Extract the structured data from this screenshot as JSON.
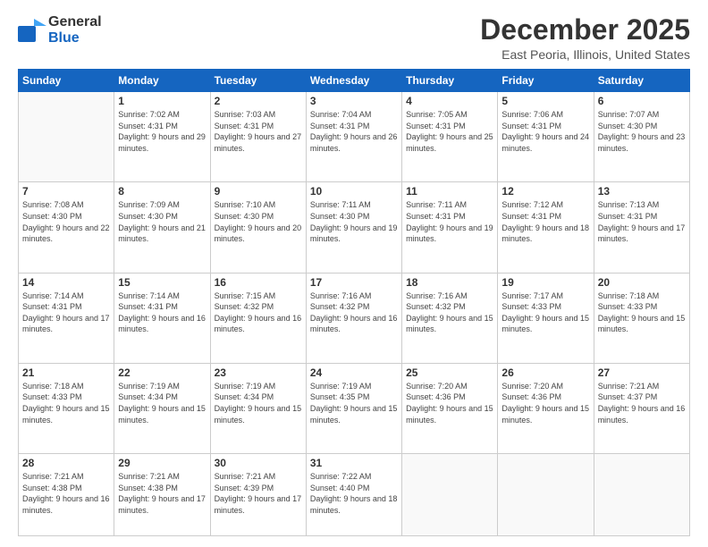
{
  "logo": {
    "general": "General",
    "blue": "Blue"
  },
  "header": {
    "month": "December 2025",
    "location": "East Peoria, Illinois, United States"
  },
  "weekdays": [
    "Sunday",
    "Monday",
    "Tuesday",
    "Wednesday",
    "Thursday",
    "Friday",
    "Saturday"
  ],
  "weeks": [
    [
      {
        "day": "",
        "sunrise": "",
        "sunset": "",
        "daylight": ""
      },
      {
        "day": "1",
        "sunrise": "Sunrise: 7:02 AM",
        "sunset": "Sunset: 4:31 PM",
        "daylight": "Daylight: 9 hours and 29 minutes."
      },
      {
        "day": "2",
        "sunrise": "Sunrise: 7:03 AM",
        "sunset": "Sunset: 4:31 PM",
        "daylight": "Daylight: 9 hours and 27 minutes."
      },
      {
        "day": "3",
        "sunrise": "Sunrise: 7:04 AM",
        "sunset": "Sunset: 4:31 PM",
        "daylight": "Daylight: 9 hours and 26 minutes."
      },
      {
        "day": "4",
        "sunrise": "Sunrise: 7:05 AM",
        "sunset": "Sunset: 4:31 PM",
        "daylight": "Daylight: 9 hours and 25 minutes."
      },
      {
        "day": "5",
        "sunrise": "Sunrise: 7:06 AM",
        "sunset": "Sunset: 4:31 PM",
        "daylight": "Daylight: 9 hours and 24 minutes."
      },
      {
        "day": "6",
        "sunrise": "Sunrise: 7:07 AM",
        "sunset": "Sunset: 4:30 PM",
        "daylight": "Daylight: 9 hours and 23 minutes."
      }
    ],
    [
      {
        "day": "7",
        "sunrise": "Sunrise: 7:08 AM",
        "sunset": "Sunset: 4:30 PM",
        "daylight": "Daylight: 9 hours and 22 minutes."
      },
      {
        "day": "8",
        "sunrise": "Sunrise: 7:09 AM",
        "sunset": "Sunset: 4:30 PM",
        "daylight": "Daylight: 9 hours and 21 minutes."
      },
      {
        "day": "9",
        "sunrise": "Sunrise: 7:10 AM",
        "sunset": "Sunset: 4:30 PM",
        "daylight": "Daylight: 9 hours and 20 minutes."
      },
      {
        "day": "10",
        "sunrise": "Sunrise: 7:11 AM",
        "sunset": "Sunset: 4:30 PM",
        "daylight": "Daylight: 9 hours and 19 minutes."
      },
      {
        "day": "11",
        "sunrise": "Sunrise: 7:11 AM",
        "sunset": "Sunset: 4:31 PM",
        "daylight": "Daylight: 9 hours and 19 minutes."
      },
      {
        "day": "12",
        "sunrise": "Sunrise: 7:12 AM",
        "sunset": "Sunset: 4:31 PM",
        "daylight": "Daylight: 9 hours and 18 minutes."
      },
      {
        "day": "13",
        "sunrise": "Sunrise: 7:13 AM",
        "sunset": "Sunset: 4:31 PM",
        "daylight": "Daylight: 9 hours and 17 minutes."
      }
    ],
    [
      {
        "day": "14",
        "sunrise": "Sunrise: 7:14 AM",
        "sunset": "Sunset: 4:31 PM",
        "daylight": "Daylight: 9 hours and 17 minutes."
      },
      {
        "day": "15",
        "sunrise": "Sunrise: 7:14 AM",
        "sunset": "Sunset: 4:31 PM",
        "daylight": "Daylight: 9 hours and 16 minutes."
      },
      {
        "day": "16",
        "sunrise": "Sunrise: 7:15 AM",
        "sunset": "Sunset: 4:32 PM",
        "daylight": "Daylight: 9 hours and 16 minutes."
      },
      {
        "day": "17",
        "sunrise": "Sunrise: 7:16 AM",
        "sunset": "Sunset: 4:32 PM",
        "daylight": "Daylight: 9 hours and 16 minutes."
      },
      {
        "day": "18",
        "sunrise": "Sunrise: 7:16 AM",
        "sunset": "Sunset: 4:32 PM",
        "daylight": "Daylight: 9 hours and 15 minutes."
      },
      {
        "day": "19",
        "sunrise": "Sunrise: 7:17 AM",
        "sunset": "Sunset: 4:33 PM",
        "daylight": "Daylight: 9 hours and 15 minutes."
      },
      {
        "day": "20",
        "sunrise": "Sunrise: 7:18 AM",
        "sunset": "Sunset: 4:33 PM",
        "daylight": "Daylight: 9 hours and 15 minutes."
      }
    ],
    [
      {
        "day": "21",
        "sunrise": "Sunrise: 7:18 AM",
        "sunset": "Sunset: 4:33 PM",
        "daylight": "Daylight: 9 hours and 15 minutes."
      },
      {
        "day": "22",
        "sunrise": "Sunrise: 7:19 AM",
        "sunset": "Sunset: 4:34 PM",
        "daylight": "Daylight: 9 hours and 15 minutes."
      },
      {
        "day": "23",
        "sunrise": "Sunrise: 7:19 AM",
        "sunset": "Sunset: 4:34 PM",
        "daylight": "Daylight: 9 hours and 15 minutes."
      },
      {
        "day": "24",
        "sunrise": "Sunrise: 7:19 AM",
        "sunset": "Sunset: 4:35 PM",
        "daylight": "Daylight: 9 hours and 15 minutes."
      },
      {
        "day": "25",
        "sunrise": "Sunrise: 7:20 AM",
        "sunset": "Sunset: 4:36 PM",
        "daylight": "Daylight: 9 hours and 15 minutes."
      },
      {
        "day": "26",
        "sunrise": "Sunrise: 7:20 AM",
        "sunset": "Sunset: 4:36 PM",
        "daylight": "Daylight: 9 hours and 15 minutes."
      },
      {
        "day": "27",
        "sunrise": "Sunrise: 7:21 AM",
        "sunset": "Sunset: 4:37 PM",
        "daylight": "Daylight: 9 hours and 16 minutes."
      }
    ],
    [
      {
        "day": "28",
        "sunrise": "Sunrise: 7:21 AM",
        "sunset": "Sunset: 4:38 PM",
        "daylight": "Daylight: 9 hours and 16 minutes."
      },
      {
        "day": "29",
        "sunrise": "Sunrise: 7:21 AM",
        "sunset": "Sunset: 4:38 PM",
        "daylight": "Daylight: 9 hours and 17 minutes."
      },
      {
        "day": "30",
        "sunrise": "Sunrise: 7:21 AM",
        "sunset": "Sunset: 4:39 PM",
        "daylight": "Daylight: 9 hours and 17 minutes."
      },
      {
        "day": "31",
        "sunrise": "Sunrise: 7:22 AM",
        "sunset": "Sunset: 4:40 PM",
        "daylight": "Daylight: 9 hours and 18 minutes."
      },
      {
        "day": "",
        "sunrise": "",
        "sunset": "",
        "daylight": ""
      },
      {
        "day": "",
        "sunrise": "",
        "sunset": "",
        "daylight": ""
      },
      {
        "day": "",
        "sunrise": "",
        "sunset": "",
        "daylight": ""
      }
    ]
  ]
}
